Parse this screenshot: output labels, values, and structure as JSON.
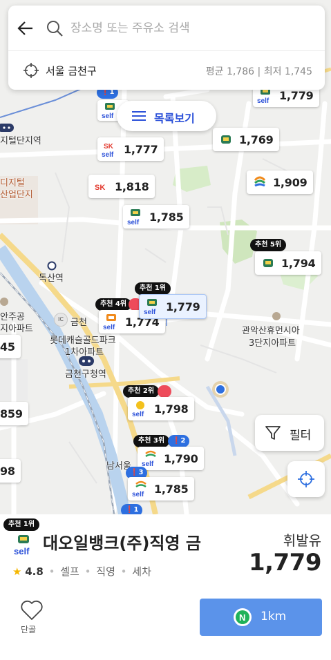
{
  "search": {
    "placeholder": "장소명 또는 주유소 검색",
    "region": "서울 금천구",
    "price_summary": "평균 1,786 | 최저 1,745"
  },
  "list_button": {
    "label": "목록보기"
  },
  "markers": [
    {
      "price": "1,779",
      "brand": "self"
    },
    {
      "price": "1,777",
      "brand": "sk-self"
    },
    {
      "price": "1,769",
      "brand": "self"
    },
    {
      "price": "1,818",
      "brand": "sk"
    },
    {
      "price": "1,909",
      "brand": "s-oil"
    },
    {
      "price": "1,785",
      "brand": "self"
    },
    {
      "price": "1,794",
      "brand": "self",
      "rank": "추천 5위"
    },
    {
      "price": "1,779",
      "brand": "self",
      "rank": "추천 1위",
      "selected": true
    },
    {
      "price": "1,774",
      "brand": "self-orange",
      "rank": "추천 4위"
    },
    {
      "price": "1,798",
      "brand": "self-yellow",
      "rank": "추천 2위"
    },
    {
      "price": "1,790",
      "brand": "s-oil-self",
      "rank": "추천 3위",
      "alert_count": "2"
    },
    {
      "price": "1,785",
      "brand": "s-oil-self"
    },
    {
      "price": "45",
      "brand": "edge"
    },
    {
      "price": "859",
      "brand": "edge"
    },
    {
      "price": "98",
      "brand": "edge"
    }
  ],
  "small_badges": [
    "1",
    "3",
    "1"
  ],
  "map_labels": [
    {
      "text": "지털단지역",
      "tone": "dark"
    },
    {
      "text": "디지털",
      "tone": "red"
    },
    {
      "text": "산업단지",
      "tone": "red"
    },
    {
      "text": "독산역",
      "tone": "dark"
    },
    {
      "text": "안주공",
      "tone": "dark"
    },
    {
      "text": "지아파트",
      "tone": "dark"
    },
    {
      "text": "금천",
      "tone": "dark"
    },
    {
      "text": "롯데캐슬골드파크",
      "tone": "dark"
    },
    {
      "text": "1차아파트",
      "tone": "dark"
    },
    {
      "text": "금천구청역",
      "tone": "dark"
    },
    {
      "text": "관악산휴먼시아",
      "tone": "dark"
    },
    {
      "text": "3단지아파트",
      "tone": "dark"
    },
    {
      "text": "남서울",
      "tone": "dark"
    },
    {
      "text": "IC",
      "tone": "dark"
    }
  ],
  "filter": {
    "label": "필터"
  },
  "station": {
    "rank": "추천 1위",
    "name": "대오일뱅크(주)직영 금",
    "rating": "4.8",
    "tags": [
      "셀프",
      "직영",
      "세차"
    ],
    "fuel": "휘발유",
    "price": "1,779",
    "fav_label": "단골",
    "distance": "1km"
  },
  "colors": {
    "accent": "#2d52d9",
    "nav_button": "#5b93ea",
    "river": "#b9d3ee",
    "road_main": "#f5d98a",
    "park": "#c9e4b4"
  }
}
